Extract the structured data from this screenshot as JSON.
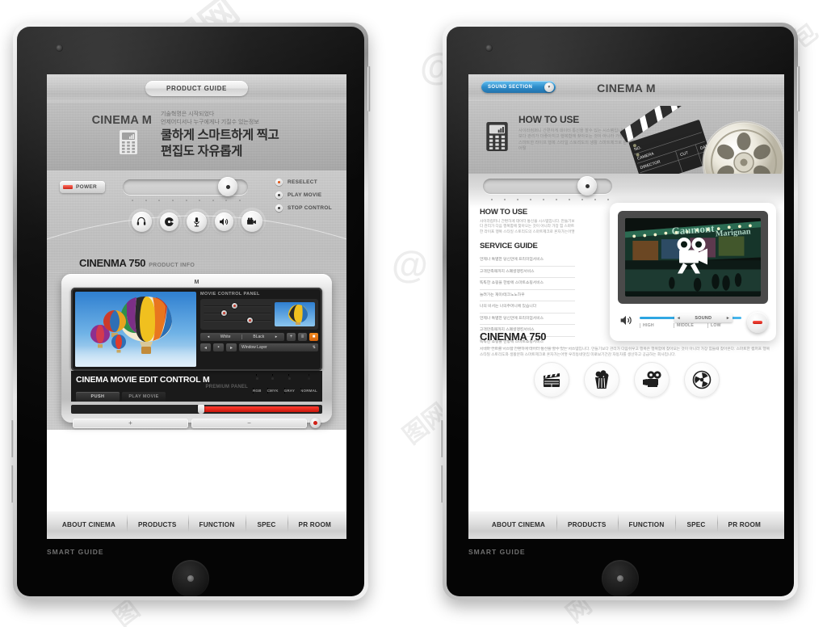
{
  "page": {
    "background": "#ffffff",
    "accent_blue": "#1f86c8",
    "accent_red": "#c9170c",
    "accent_orange": "#e2510f"
  },
  "left_tablet": {
    "name": "Tablet device mockup (left)",
    "screen": {
      "topbar": {
        "product_guide": "PRODUCT GUIDE"
      },
      "hero": {
        "brand": "CINEMA M",
        "sub_line1": "기술혁명은 시작되었다",
        "sub_line2": "언제어디서나 누구에게나 기질수 있는정보",
        "headline1": "쿨하게 스마트하게 찍고",
        "headline2": "편집도 자유롭게"
      },
      "controls": {
        "power_label": "POWER",
        "radios": [
          {
            "label": "RESELECT",
            "state": "on"
          },
          {
            "label": "PLAY MOVIE",
            "state": "off"
          },
          {
            "label": "STOP CONTROL",
            "state": "off"
          }
        ],
        "icon_buttons": [
          "headphones-icon",
          "disc-icon",
          "microphone-icon",
          "speaker-icon",
          "film-camera-icon"
        ]
      },
      "product": {
        "title": "CINENMA 750",
        "subtitle": "PRODUCT INFO"
      },
      "device": {
        "brand_mark": "M",
        "panel_title": "MOVIE CONTROL PANEL",
        "white_label": "White",
        "black_label": "BLack",
        "layer_label": "Window Layer",
        "title": "CINEMA MOVIE EDIT CONTROL M",
        "subtitle": "PREMIUM PANEL",
        "buttons": [
          "PUSH",
          "PLAY MOVIE"
        ],
        "color_modes": [
          "RGB",
          "CMYK",
          "GRAY",
          "NORMAL"
        ],
        "zoom_in": "+",
        "zoom_out": "−"
      },
      "nav": [
        "ABOUT CINEMA",
        "PRODUCTS",
        "FUNCTION",
        "SPEC",
        "PR ROOM"
      ]
    },
    "caption": "SMART GUIDE"
  },
  "right_tablet": {
    "name": "Tablet device mockup (right)",
    "screen": {
      "topbar": {
        "badge": "SOUND SECTION",
        "title": "CINEMA M"
      },
      "hero": {
        "heading": "HOW TO USE",
        "body": "사이라컴퍼니 간편하게 데이터 통신을 할수 있는 시스템입니다. 만들기보다 관리가 더좋아지고 행복함에 찾아오는 것이 아니라 가장 힘들때 스마트한 라이프 행복 스타일 스토리도의 생활 스마트제크로 혼자가는어떻"
      },
      "service": {
        "how_to_use_title": "HOW TO USE",
        "how_to_use_body": "사이라컴퍼니 간편하게 데이터 통신을 시스템입니다. 만들기보다 관리가 다음 행복함에 찾아오는 것이 아니라 가장 힘 스마트한 라이프 행복 스타일 스토리도의 스마트제크로 혼자가는어떻",
        "guide_title": "SERVICE GUIDE",
        "items": [
          "언제나 특별한 당신만에 프리미엄서비스",
          "고객만족때까지 스폐셜맹킹서비스",
          "똑똑한 쇼핑을 한방에 스마트쇼핑서비스",
          "늘려가는 재미!테크노노하우",
          "나의 비서는 나의주머니에 있습니다",
          "언제나 특별한 당신만에 프리미엄서비스",
          "고객만족때까지 스폐셜맹킹서비스",
          "똑똑한 쇼핑을 한방에 스마트쇼핑서비스"
        ]
      },
      "player": {
        "video_sign": "Gaumont Marignan",
        "play_icon": "movie-camera-play-icon",
        "sound_label": "SOUND",
        "levels": [
          "HIGH",
          "MIDDLE",
          "LOW"
        ]
      },
      "lower": {
        "title": "CINENMA 750",
        "body": "시네마 컨트롤 시스템 간편하게 데이터 통신을 할수 있는 시스템입니다. 만들기보다 관리가 다음쉬우고 행복은 행복함에 찾아오는 것이 아니라 가장 힘들때 찾아온다. 스마트한 캠퍼프 행복 스타일 스토리도와 생활문화 스마트제크로 혼자가는어떻 우리동네맛집 미로보기간감 자동차를 생산하고 공급하는 회사입니다.",
        "circles": [
          "clapperboard-icon",
          "popcorn-icon",
          "movie-camera-icon",
          "film-reel-icon"
        ]
      },
      "nav": [
        "ABOUT CINEMA",
        "PRODUCTS",
        "FUNCTION",
        "SPEC",
        "PR ROOM"
      ]
    },
    "caption": "SMART GUIDE"
  },
  "watermarks": [
    "@",
    "图",
    "网",
    "包",
    "G"
  ]
}
